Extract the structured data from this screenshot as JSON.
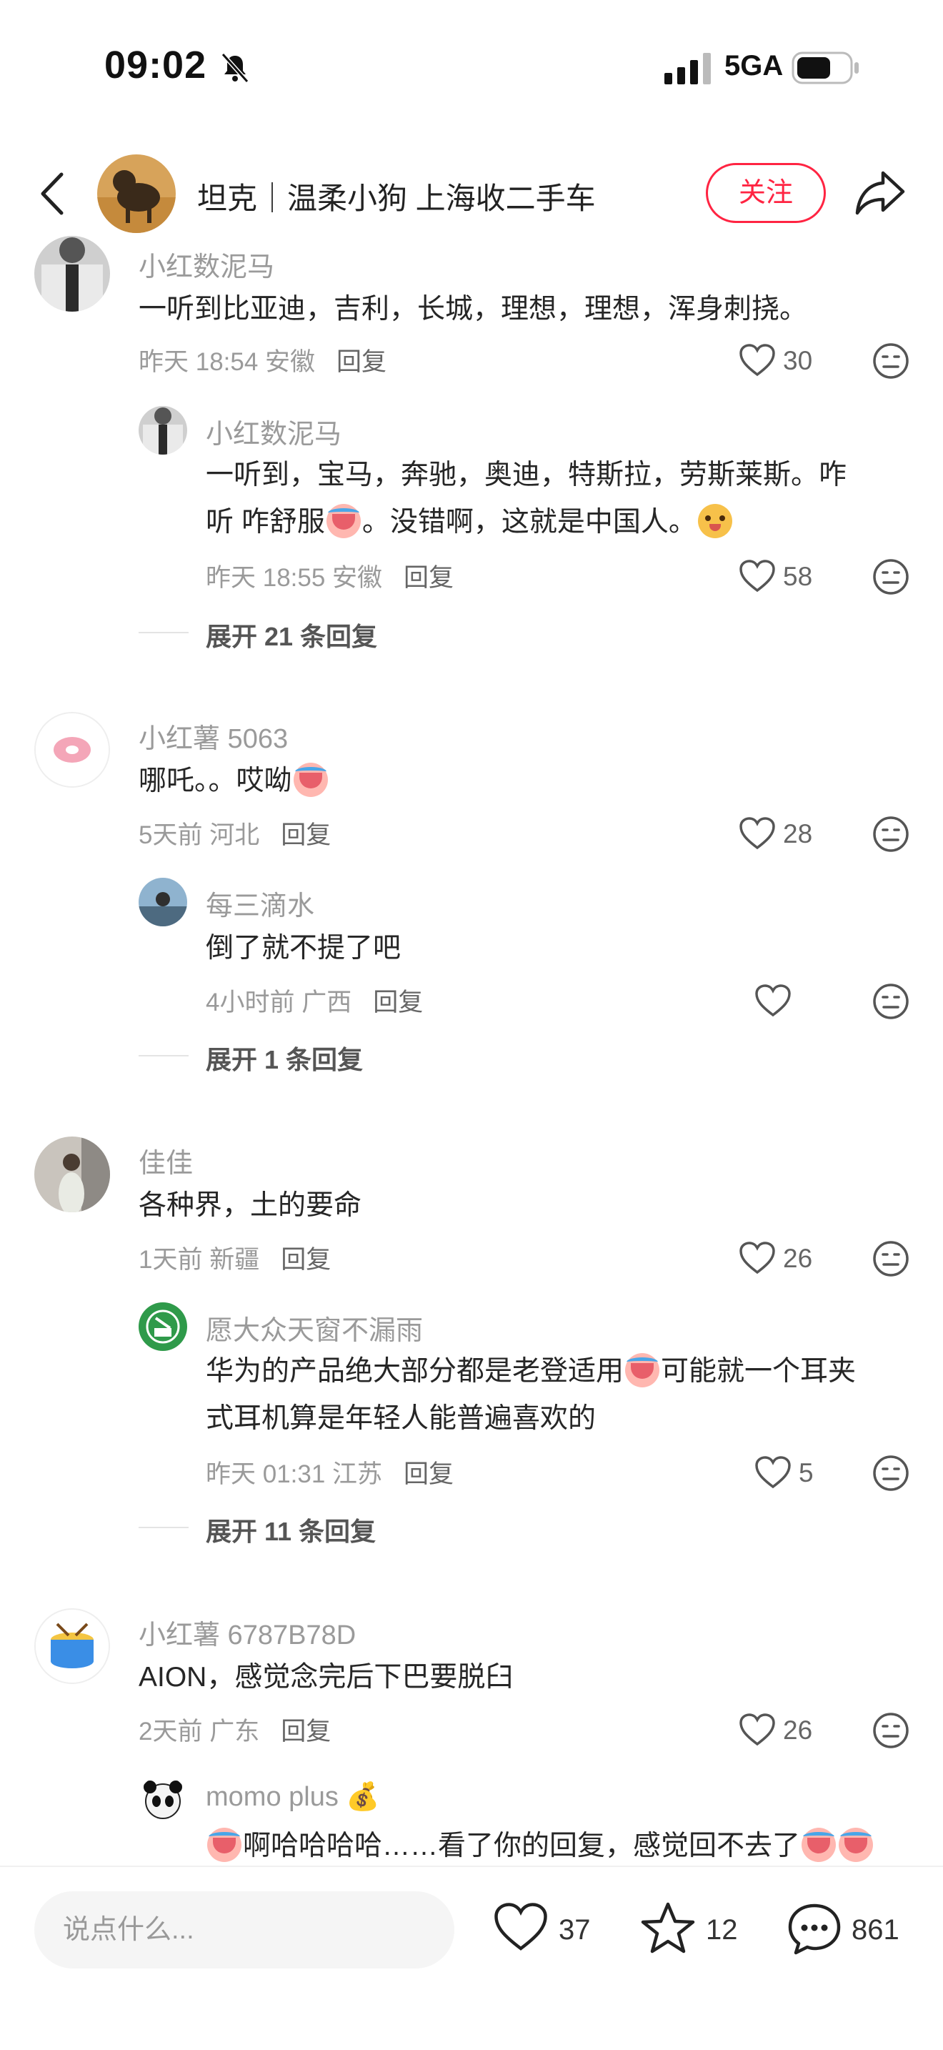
{
  "status": {
    "time": "09:02",
    "network": "5GA"
  },
  "header": {
    "title": "坦克｜温柔小狗 上海收二手车",
    "follow_label": "关注"
  },
  "comments": [
    {
      "name": "小红数泥马",
      "text": "一听到比亚迪，吉利，长城，理想，理想，浑身刺挠。",
      "time": "昨天 18:54 安徽",
      "reply": "回复",
      "likes": "30",
      "replies": [
        {
          "name": "小红数泥马",
          "text1": "一听到，宝马，奔驰，奥迪，特斯拉，劳斯莱斯。咋",
          "text2a": "听 咋舒服",
          "text2b": "。没错啊，这就是中国人。",
          "time": "昨天 18:55 安徽",
          "reply": "回复",
          "likes": "58"
        }
      ],
      "expand": "展开 21 条回复"
    },
    {
      "name": "小红薯 5063",
      "text": "哪吒。。哎呦",
      "time": "5天前 河北",
      "reply": "回复",
      "likes": "28",
      "replies": [
        {
          "name": "每三滴水",
          "text": "倒了就不提了吧",
          "time": "4小时前 广西",
          "reply": "回复",
          "likes": ""
        }
      ],
      "expand": "展开 1 条回复"
    },
    {
      "name": "佳佳",
      "text": "各种界，土的要命",
      "time": "1天前 新疆",
      "reply": "回复",
      "likes": "26",
      "replies": [
        {
          "name": "愿大众天窗不漏雨",
          "text1": "华为的产品绝大部分都是老登适用",
          "text1b": "可能就一个耳夹",
          "text2": "式耳机算是年轻人能普遍喜欢的",
          "time": "昨天 01:31 江苏",
          "reply": "回复",
          "likes": "5"
        }
      ],
      "expand": "展开 11 条回复"
    },
    {
      "name": "小红薯 6787B78D",
      "text": "AION，感觉念完后下巴要脱臼",
      "time": "2天前 广东",
      "reply": "回复",
      "likes": "26",
      "replies": [
        {
          "name": "momo plus",
          "name_emoji": "💰",
          "text": "啊哈哈哈哈……看了你的回复，感觉回不去了"
        }
      ]
    }
  ],
  "bottom": {
    "input_placeholder": "说点什么...",
    "likes": "37",
    "stars": "12",
    "comments": "861"
  },
  "colors": {
    "accent": "#ff2442",
    "muted": "#9a9a9a"
  },
  "icons": [
    "bell-slash-icon",
    "signal-icon",
    "battery-icon",
    "back-icon",
    "share-icon",
    "heart-icon",
    "dislike-face-icon",
    "star-icon",
    "comment-icon"
  ]
}
